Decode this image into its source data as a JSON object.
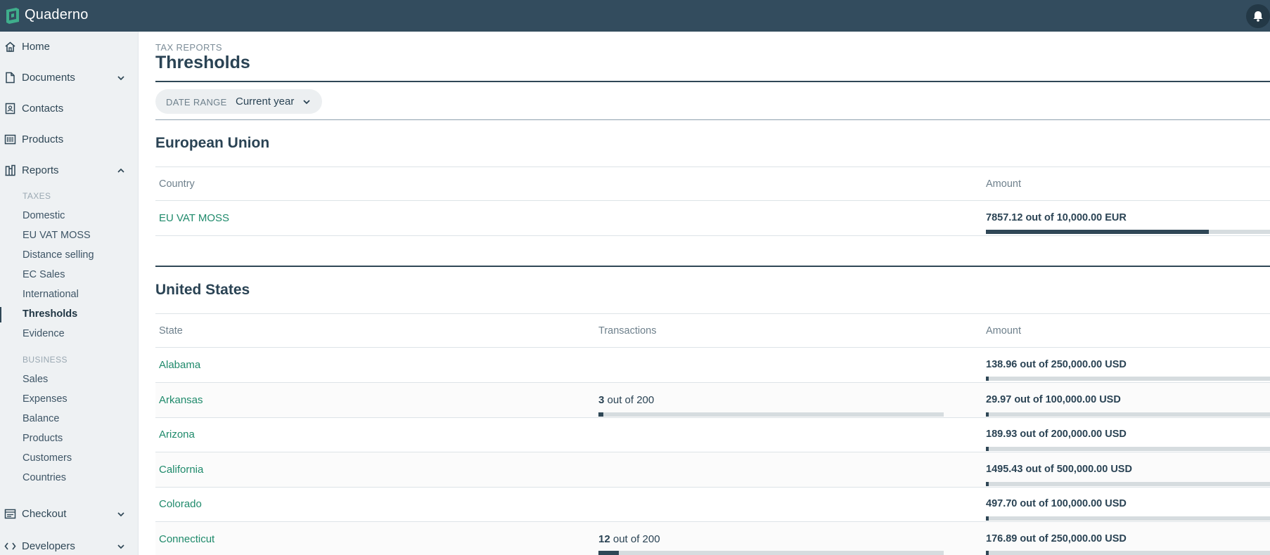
{
  "app": {
    "brand": "Quaderno"
  },
  "sidebar": {
    "items": [
      {
        "label": "Home",
        "icon": "home-icon"
      },
      {
        "label": "Documents",
        "icon": "document-icon",
        "expanded": false
      },
      {
        "label": "Contacts",
        "icon": "contacts-icon"
      },
      {
        "label": "Products",
        "icon": "products-icon"
      },
      {
        "label": "Reports",
        "icon": "reports-icon",
        "expanded": true
      },
      {
        "label": "Checkout",
        "icon": "checkout-icon",
        "expanded": false
      },
      {
        "label": "Developers",
        "icon": "developers-icon",
        "expanded": false
      }
    ],
    "taxes_title": "TAXES",
    "taxes": [
      "Domestic",
      "EU VAT MOSS",
      "Distance selling",
      "EC Sales",
      "International",
      "Thresholds",
      "Evidence"
    ],
    "business_title": "BUSINESS",
    "business": [
      "Sales",
      "Expenses",
      "Balance",
      "Products",
      "Customers",
      "Countries"
    ],
    "active": "Thresholds"
  },
  "page": {
    "breadcrumb": "TAX REPORTS",
    "title": "Thresholds",
    "date_range_label": "DATE RANGE",
    "date_range_value": "Current year"
  },
  "eu": {
    "title": "European Union",
    "columns": [
      "Country",
      "Amount"
    ],
    "rows": [
      {
        "name": "EU VAT MOSS",
        "amount": "7857.12 out of 10,000.00 EUR",
        "amount_progress": 0.7857
      }
    ]
  },
  "us": {
    "title": "United States",
    "columns": [
      "State",
      "Transactions",
      "Amount"
    ],
    "rows": [
      {
        "name": "Alabama",
        "trans_count": "",
        "trans_total": "",
        "trans_progress": null,
        "amount": "138.96 out of 250,000.00 USD",
        "amount_progress": 0.0006
      },
      {
        "name": "Arkansas",
        "trans_count": "3",
        "trans_total": " out of 200",
        "trans_progress": 0.015,
        "amount": "29.97 out of 100,000.00 USD",
        "amount_progress": 0.0003
      },
      {
        "name": "Arizona",
        "trans_count": "",
        "trans_total": "",
        "trans_progress": null,
        "amount": "189.93 out of 200,000.00 USD",
        "amount_progress": 0.0009
      },
      {
        "name": "California",
        "trans_count": "",
        "trans_total": "",
        "trans_progress": null,
        "amount": "1495.43 out of 500,000.00 USD",
        "amount_progress": 0.003
      },
      {
        "name": "Colorado",
        "trans_count": "",
        "trans_total": "",
        "trans_progress": null,
        "amount": "497.70 out of 100,000.00 USD",
        "amount_progress": 0.005
      },
      {
        "name": "Connecticut",
        "trans_count": "12",
        "trans_total": " out of 200",
        "trans_progress": 0.06,
        "amount": "176.89 out of 250,000.00 USD",
        "amount_progress": 0.0007
      }
    ]
  }
}
